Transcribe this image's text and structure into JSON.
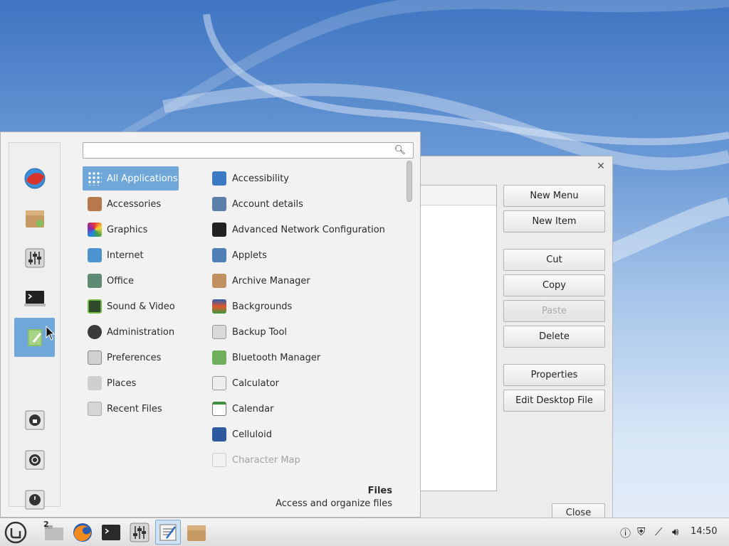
{
  "editor": {
    "buttons": [
      "New Menu",
      "New Item",
      "Cut",
      "Copy",
      "Paste",
      "Delete",
      "Properties",
      "Edit Desktop File"
    ],
    "close_label": "Close"
  },
  "menu": {
    "search_placeholder": "",
    "categories": [
      "All Applications",
      "Accessories",
      "Graphics",
      "Internet",
      "Office",
      "Sound & Video",
      "Administration",
      "Preferences",
      "Places",
      "Recent Files"
    ],
    "apps": [
      "Accessibility",
      "Account details",
      "Advanced Network Configuration",
      "Applets",
      "Archive Manager",
      "Backgrounds",
      "Backup Tool",
      "Bluetooth Manager",
      "Calculator",
      "Calendar",
      "Celluloid",
      "Character Map"
    ],
    "description": {
      "title": "Files",
      "text": "Access and organize files"
    }
  },
  "taskbar": {
    "workspace_badge": "2",
    "clock": "14:50"
  },
  "colors": {
    "accent": "#6fa8d8"
  }
}
